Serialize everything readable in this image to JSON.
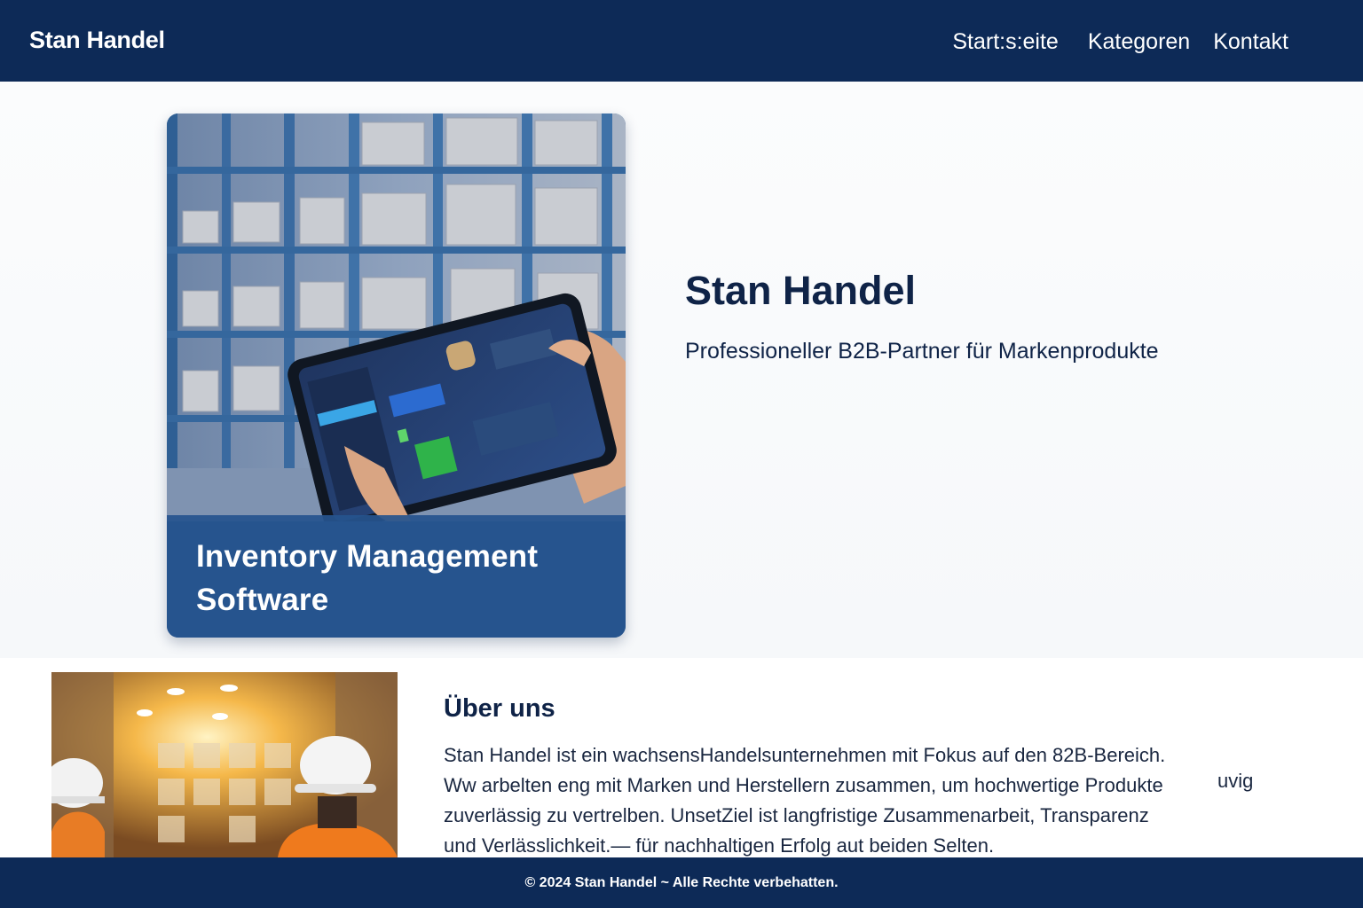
{
  "header": {
    "brand": "Stan Handel",
    "nav": [
      "Start:s:eite",
      "Kategoren",
      "Kontakt"
    ]
  },
  "hero": {
    "card_caption_line1": "Inventory Management",
    "card_caption_line2": "Software",
    "title": "Stan Handel",
    "subtitle": "Professioneller B2B-Partner für Markenprodukte"
  },
  "about": {
    "title": "Über uns",
    "lines": [
      "Stan Handel ist ein wachsensHandelsunternehmen mit Fokus auf den 82B-Bereich.",
      "Ww arbelten eng mit Marken und Herstellern zusammen, um hochwertige Produkte",
      "zuverlässig zu vertrelben. UnsetZiel ist langfristige Zusammenarbeit, Transparenz",
      "und Verlässlichkeit.— für nachhaltigen Erfolg aut beiden Selten."
    ],
    "stray": "uvig"
  },
  "footer": {
    "text": "© 2024 Stan Handel ~ Alle Rechte verbehatten."
  },
  "colors": {
    "navy": "#0d2a57",
    "card_blue": "#26548e",
    "text_dark": "#0f2347"
  },
  "images": [
    "warehouse-tablet-image",
    "warehouse-workers-image"
  ]
}
